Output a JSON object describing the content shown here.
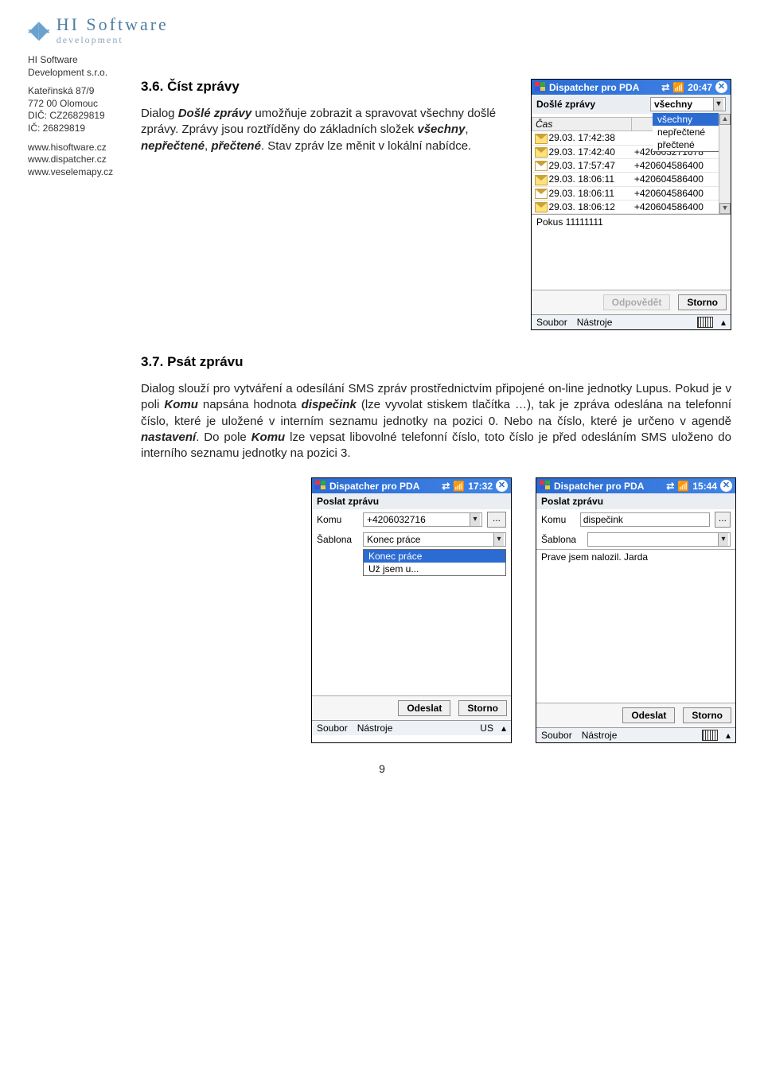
{
  "logo": {
    "brand": "HI Software",
    "sub": "development"
  },
  "company": {
    "name": "HI Software",
    "form": "Development s.r.o.",
    "addr1": "Kateřinská 87/9",
    "addr2": "772 00 Olomouc",
    "dic": "DIČ: CZ26829819",
    "ic": "IČ: 26829819",
    "url1": "www.hisoftware.cz",
    "url2": "www.dispatcher.cz",
    "url3": "www.veselemapy.cz"
  },
  "sec36": {
    "title": "3.6. Číst zprávy",
    "p1a": "Dialog ",
    "p1b": "Došlé zprávy",
    "p1c": " umožňuje zobrazit a spravovat všechny došlé zprávy. Zprávy jsou roztříděny do základních složek ",
    "p1d": "všechny",
    "p1e": ", ",
    "p1f": "nepřečtené",
    "p1g": ", ",
    "p1h": "přečtené",
    "p1i": ". Stav zpráv lze měnit v lokální nabídce."
  },
  "sec37": {
    "title": "3.7. Psát zprávu",
    "p1a": "Dialog slouží pro vytváření a odesílání SMS zpráv prostřednictvím připojené on-line jednotky Lupus. Pokud je v poli ",
    "p1b": "Komu",
    "p1c": " napsána hodnota ",
    "p1d": "dispečink",
    "p1e": " (lze vyvolat stiskem tlačítka …), tak je zpráva odeslána na telefonní číslo, které je uložené v interním seznamu jednotky na pozici 0. Nebo na číslo, které je určeno v agendě ",
    "p1f": "nastavení",
    "p1g": ". Do pole ",
    "p1h": "Komu",
    "p1i": " lze vepsat libovolné telefonní číslo, toto číslo je před odesláním SMS uloženo do interního seznamu jednotky na pozici 3."
  },
  "pda1": {
    "title": "Dispatcher pro PDA",
    "time": "20:47",
    "screenTitle": "Došlé zprávy",
    "filterSelected": "všechny",
    "filterOptions": [
      "všechny",
      "nepřečtené",
      "přečtené"
    ],
    "colTime": "Čas",
    "rows": [
      {
        "open": false,
        "time": "29.03. 17:42:38",
        "num": ""
      },
      {
        "open": false,
        "time": "29.03. 17:42:40",
        "num": "+420603271678"
      },
      {
        "open": true,
        "time": "29.03. 17:57:47",
        "num": "+420604586400"
      },
      {
        "open": false,
        "time": "29.03. 18:06:11",
        "num": "+420604586400"
      },
      {
        "open": true,
        "time": "29.03. 18:06:11",
        "num": "+420604586400"
      },
      {
        "open": false,
        "time": "29.03. 18:06:12",
        "num": "+420604586400"
      }
    ],
    "preview": "Pokus 11111111",
    "btnReply": "Odpovědět",
    "btnCancel": "Storno",
    "menu1": "Soubor",
    "menu2": "Nástroje"
  },
  "pda2": {
    "title": "Dispatcher pro PDA",
    "time": "17:32",
    "screenTitle": "Poslat zprávu",
    "lblTo": "Komu",
    "valTo": "+4206032716",
    "lblTpl": "Šablona",
    "valTpl": "Konec práce",
    "tplOptions": [
      "Konec práce",
      "Už jsem u..."
    ],
    "btnSend": "Odeslat",
    "btnCancel": "Storno",
    "menu1": "Soubor",
    "menu2": "Nástroje",
    "kbLabel": "US"
  },
  "pda3": {
    "title": "Dispatcher pro PDA",
    "time": "15:44",
    "screenTitle": "Poslat zprávu",
    "lblTo": "Komu",
    "valTo": "dispečink",
    "lblTpl": "Šablona",
    "body": "Prave jsem nalozil. Jarda",
    "btnSend": "Odeslat",
    "btnCancel": "Storno",
    "menu1": "Soubor",
    "menu2": "Nástroje"
  },
  "pageNumber": "9"
}
